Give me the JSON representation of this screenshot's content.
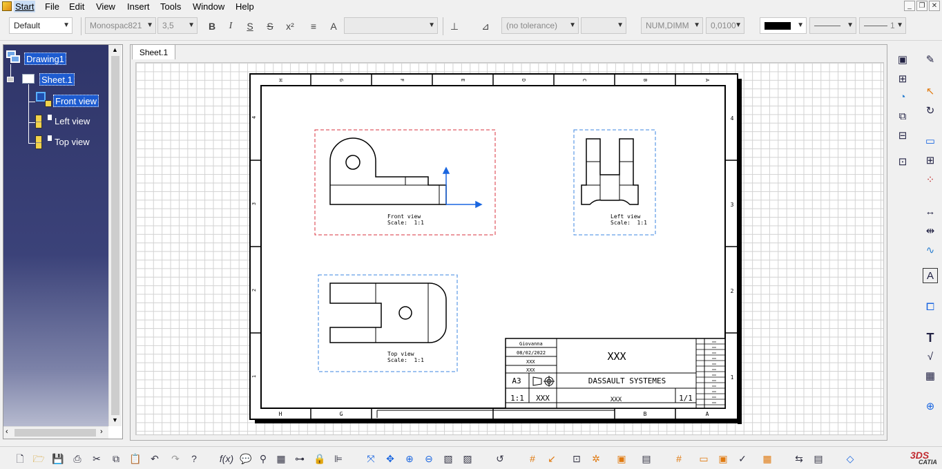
{
  "menu": {
    "start": "Start",
    "file": "File",
    "edit": "Edit",
    "view": "View",
    "insert": "Insert",
    "tools": "Tools",
    "window": "Window",
    "help": "Help"
  },
  "toolbar": {
    "style": "Default",
    "font_name": "Monospac821",
    "font_size": "3,5",
    "tolerance": "(no tolerance)",
    "dim_type": "NUM,DIMM",
    "precision": "0,0100",
    "line_weight": "1"
  },
  "tree": {
    "root": "Drawing1",
    "sheet": "Sheet.1",
    "views": [
      "Front view",
      "Left view",
      "Top view"
    ]
  },
  "tabs": [
    "Sheet.1"
  ],
  "frame": {
    "top_letters": [
      "H",
      "G",
      "F",
      "E",
      "D",
      "C",
      "B",
      "A"
    ],
    "bottom_letters": [
      "H",
      "G",
      "B",
      "A"
    ],
    "left_numbers": [
      "4",
      "3",
      "2",
      "1"
    ],
    "right_numbers": [
      "4",
      "3",
      "2",
      "1"
    ]
  },
  "views": {
    "front": {
      "name": "Front view",
      "scale": "Scale:  1:1"
    },
    "left": {
      "name": "Left view",
      "scale": "Scale:  1:1"
    },
    "top": {
      "name": "Top view",
      "scale": "Scale:  1:1"
    }
  },
  "title_block": {
    "designer": "Giovanna",
    "date": "08/02/2022",
    "checked": "XXX",
    "approved": "XXX",
    "title": "XXX",
    "company": "DASSAULT SYSTEMES",
    "format": "A3",
    "scale": "1:1",
    "weight": "XXX",
    "drawing_number": "XXX",
    "sheet": "1/1"
  },
  "brand": {
    "logo_text": "CATIA"
  },
  "icons": {
    "menubar": [
      "catia-start-icon"
    ],
    "toolbar": [
      "bold-icon",
      "italic-icon",
      "underline-icon",
      "strikethrough-icon",
      "superscript-icon",
      "align-icon",
      "frame-icon"
    ],
    "right": [
      "view-icon",
      "section-icon",
      "detail-icon",
      "clip-icon",
      "unfold-icon",
      "select-icon",
      "geometry-icon",
      "rectangle-icon",
      "dimension-icon",
      "text-icon",
      "table-icon",
      "axis-icon"
    ],
    "bottom": [
      "new-icon",
      "open-icon",
      "save-icon",
      "print-icon",
      "cut-icon",
      "copy-icon",
      "paste-icon",
      "undo-icon",
      "redo-icon",
      "whatsnew-icon",
      "formula-icon",
      "zoom-icon",
      "pan-icon",
      "zoom-in-icon",
      "zoom-out-icon",
      "fit-all-icon",
      "grid-icon",
      "snap-icon"
    ]
  }
}
